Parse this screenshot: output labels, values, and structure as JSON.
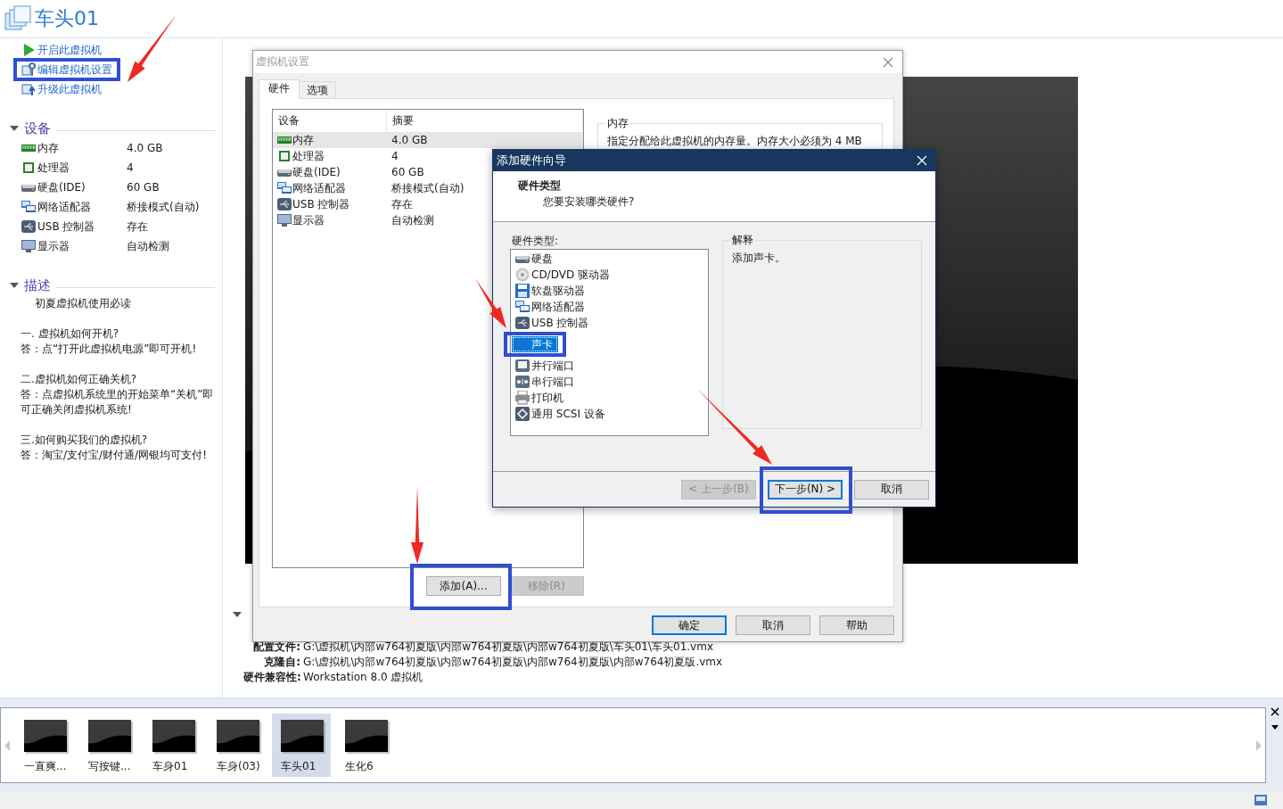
{
  "app": {
    "title": "车头01"
  },
  "actions": [
    {
      "kind": "power",
      "label": "开启此虚拟机"
    },
    {
      "kind": "edit",
      "label": "编辑虚拟机设置"
    },
    {
      "kind": "upgrade",
      "label": "升级此虚拟机"
    }
  ],
  "devices_section": {
    "title": "设备",
    "expanded": true,
    "devices": [
      {
        "kind": "memory",
        "name": "内存",
        "value": "4.0 GB"
      },
      {
        "kind": "cpu",
        "name": "处理器",
        "value": "4"
      },
      {
        "kind": "disk",
        "name": "硬盘(IDE)",
        "value": "60 GB"
      },
      {
        "kind": "network",
        "name": "网络适配器",
        "value": "桥接模式(自动)"
      },
      {
        "kind": "usb",
        "name": "USB 控制器",
        "value": "存在"
      },
      {
        "kind": "display",
        "name": "显示器",
        "value": "自动检测"
      }
    ]
  },
  "description_section": {
    "title": "描述",
    "expanded": true,
    "caption": "初夏虚拟机使用必读",
    "paragraphs": [
      {
        "question": "一. 虚拟机如何开机?",
        "answer": "答：点“打开此虚拟机电源”即可开机!"
      },
      {
        "question": "二.虚拟机如何正确关机?",
        "answer": "答：点虚拟机系统里的开始菜单“关机”即可正确关闭虚拟机系统!"
      },
      {
        "question": "三.如何购买我们的虚拟机?",
        "answer": "答：淘宝/支付宝/财付通/网银均可支付!"
      }
    ]
  },
  "details_section": {
    "expanded": true,
    "rows": [
      {
        "label": "配置文件:",
        "value": "G:\\虚拟机\\内部w764初夏版\\内部w764初夏版\\内部w764初夏版\\车头01\\车头01.vmx"
      },
      {
        "label": "克隆自:",
        "value": "G:\\虚拟机\\内部w764初夏版\\内部w764初夏版\\内部w764初夏版\\内部w764初夏版.vmx"
      },
      {
        "label": "硬件兼容性:",
        "value": "Workstation 8.0 虚拟机"
      }
    ]
  },
  "settings_dialog": {
    "title": "虚拟机设置",
    "tabs": [
      {
        "label": "硬件",
        "selected": true
      },
      {
        "label": "选项",
        "selected": false
      }
    ],
    "table": {
      "columns": [
        "设备",
        "摘要"
      ],
      "rows": [
        {
          "kind": "memory",
          "device": "内存",
          "summary": "4.0 GB",
          "selected": true
        },
        {
          "kind": "cpu",
          "device": "处理器",
          "summary": "4",
          "selected": false
        },
        {
          "kind": "disk",
          "device": "硬盘(IDE)",
          "summary": "60 GB",
          "selected": false
        },
        {
          "kind": "network",
          "device": "网络适配器",
          "summary": "桥接模式(自动)",
          "selected": false
        },
        {
          "kind": "usb",
          "device": "USB 控制器",
          "summary": "存在",
          "selected": false
        },
        {
          "kind": "display",
          "device": "显示器",
          "summary": "自动检测",
          "selected": false
        }
      ]
    },
    "detail_group": {
      "title": "内存",
      "text": "指定分配给此虚拟机的内存量。内存大小必须为 4 MB"
    },
    "panel_buttons": [
      {
        "label": "添加(A)...",
        "disabled": false
      },
      {
        "label": "移除(R)",
        "disabled": true
      }
    ],
    "buttons": [
      {
        "label": "确定",
        "default": true
      },
      {
        "label": "取消",
        "default": false
      },
      {
        "label": "帮助",
        "default": false
      }
    ]
  },
  "wizard": {
    "title": "添加硬件向导",
    "heading": "硬件类型",
    "subheading": "您要安装哪类硬件?",
    "list_label": "硬件类型:",
    "items": [
      {
        "kind": "disk",
        "label": "硬盘",
        "selected": false
      },
      {
        "kind": "cdrom",
        "label": "CD/DVD 驱动器",
        "selected": false
      },
      {
        "kind": "floppy",
        "label": "软盘驱动器",
        "selected": false
      },
      {
        "kind": "network",
        "label": "网络适配器",
        "selected": false
      },
      {
        "kind": "usb",
        "label": "USB 控制器",
        "selected": false
      },
      {
        "kind": "sound",
        "label": "声卡",
        "selected": true
      },
      {
        "kind": "parallel",
        "label": "并行端口",
        "selected": false
      },
      {
        "kind": "serial",
        "label": "串行端口",
        "selected": false
      },
      {
        "kind": "printer",
        "label": "打印机",
        "selected": false
      },
      {
        "kind": "scsi",
        "label": "通用 SCSI 设备",
        "selected": false
      }
    ],
    "explanation": {
      "title": "解释",
      "text": "添加声卡。"
    },
    "buttons": [
      {
        "label": "< 上一步(B)",
        "disabled": true,
        "default": false
      },
      {
        "label": "下一步(N) >",
        "disabled": false,
        "default": true
      },
      {
        "label": "取消",
        "disabled": false,
        "default": false
      }
    ]
  },
  "thumbnails": [
    {
      "label": "一直爽...",
      "selected": false
    },
    {
      "label": "写按键...",
      "selected": false
    },
    {
      "label": "车身01",
      "selected": false
    },
    {
      "label": "车身(03)",
      "selected": false
    },
    {
      "label": "车头01",
      "selected": true
    },
    {
      "label": "生化6",
      "selected": false
    }
  ]
}
